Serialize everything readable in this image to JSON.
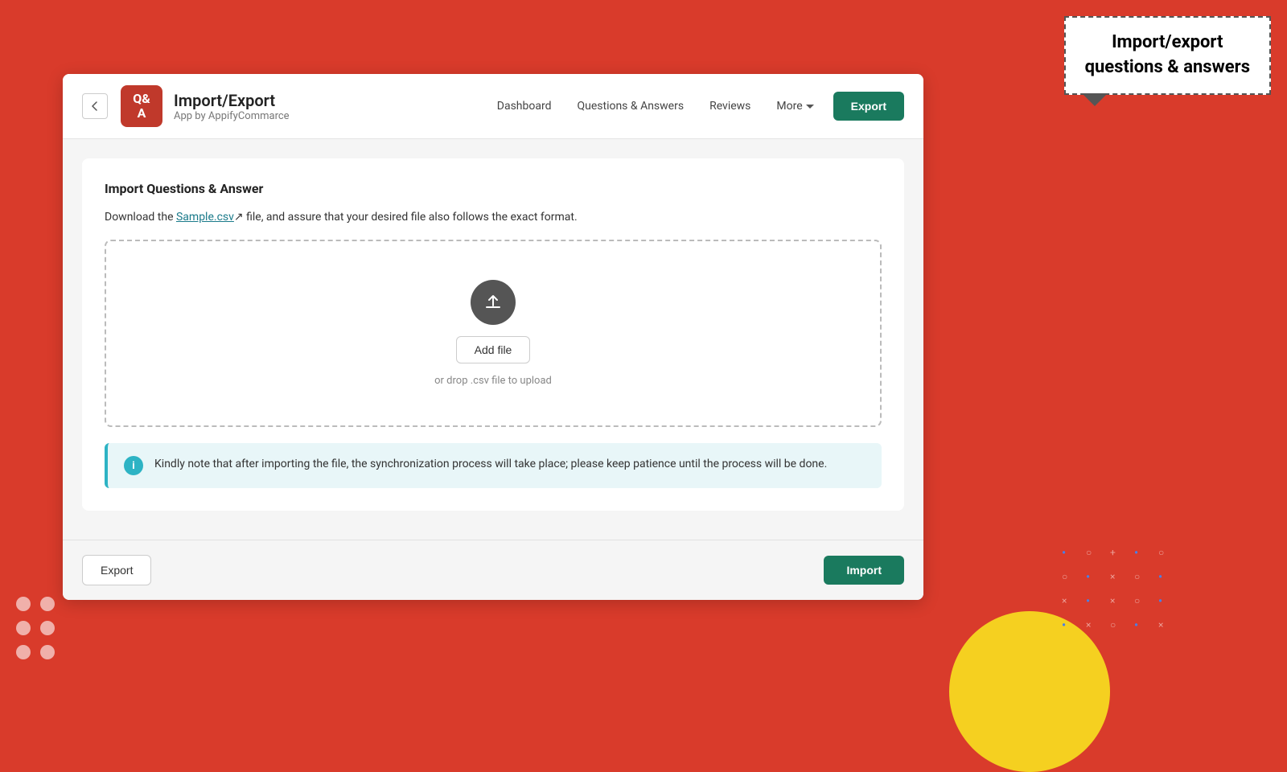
{
  "background": {
    "color": "#d93b2b"
  },
  "annotation": {
    "title": "Import/export\nquestions & answers"
  },
  "header": {
    "back_label": "←",
    "logo_text": "Q\nA",
    "app_title": "Import/Export",
    "app_subtitle": "App by AppifyCommarce",
    "nav_items": [
      {
        "label": "Dashboard",
        "key": "dashboard"
      },
      {
        "label": "Questions & Answers",
        "key": "questions-answers"
      },
      {
        "label": "Reviews",
        "key": "reviews"
      },
      {
        "label": "More",
        "key": "more"
      }
    ],
    "export_button_label": "Export"
  },
  "main": {
    "section_title": "Import Questions & Answer",
    "instruction_prefix": "Download the ",
    "sample_link_text": "Sample.csv",
    "instruction_suffix": " file, and assure that your desired file also follows the exact format.",
    "upload_zone": {
      "add_file_label": "Add file",
      "drop_hint": "or drop .csv file to upload"
    },
    "info_notice": {
      "icon_label": "i",
      "text": "Kindly note that after importing the file, the synchronization process will take place; please keep patience until the process will be done."
    }
  },
  "footer": {
    "export_label": "Export",
    "import_label": "Import"
  }
}
